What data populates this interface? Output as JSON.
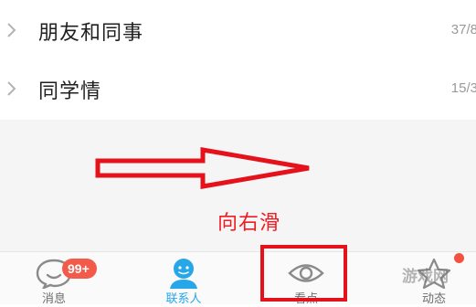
{
  "groups": [
    {
      "name": "朋友和同事",
      "count": "37/8"
    },
    {
      "name": "同学情",
      "count": "15/3"
    }
  ],
  "annotation": {
    "hint_text": "向右滑",
    "arrow_color": "#e5121b"
  },
  "tabbar": {
    "tabs": [
      {
        "label": "消息",
        "icon": "chat-bubble-icon"
      },
      {
        "label": "联系人",
        "icon": "contacts-person-icon"
      },
      {
        "label": "看点",
        "icon": "eye-icon"
      },
      {
        "label": "动态",
        "icon": "star-icon"
      }
    ],
    "messages_badge": "99+",
    "accent_color": "#27a7e8",
    "badge_color": "#f45a4a"
  },
  "watermark": "游戏网"
}
